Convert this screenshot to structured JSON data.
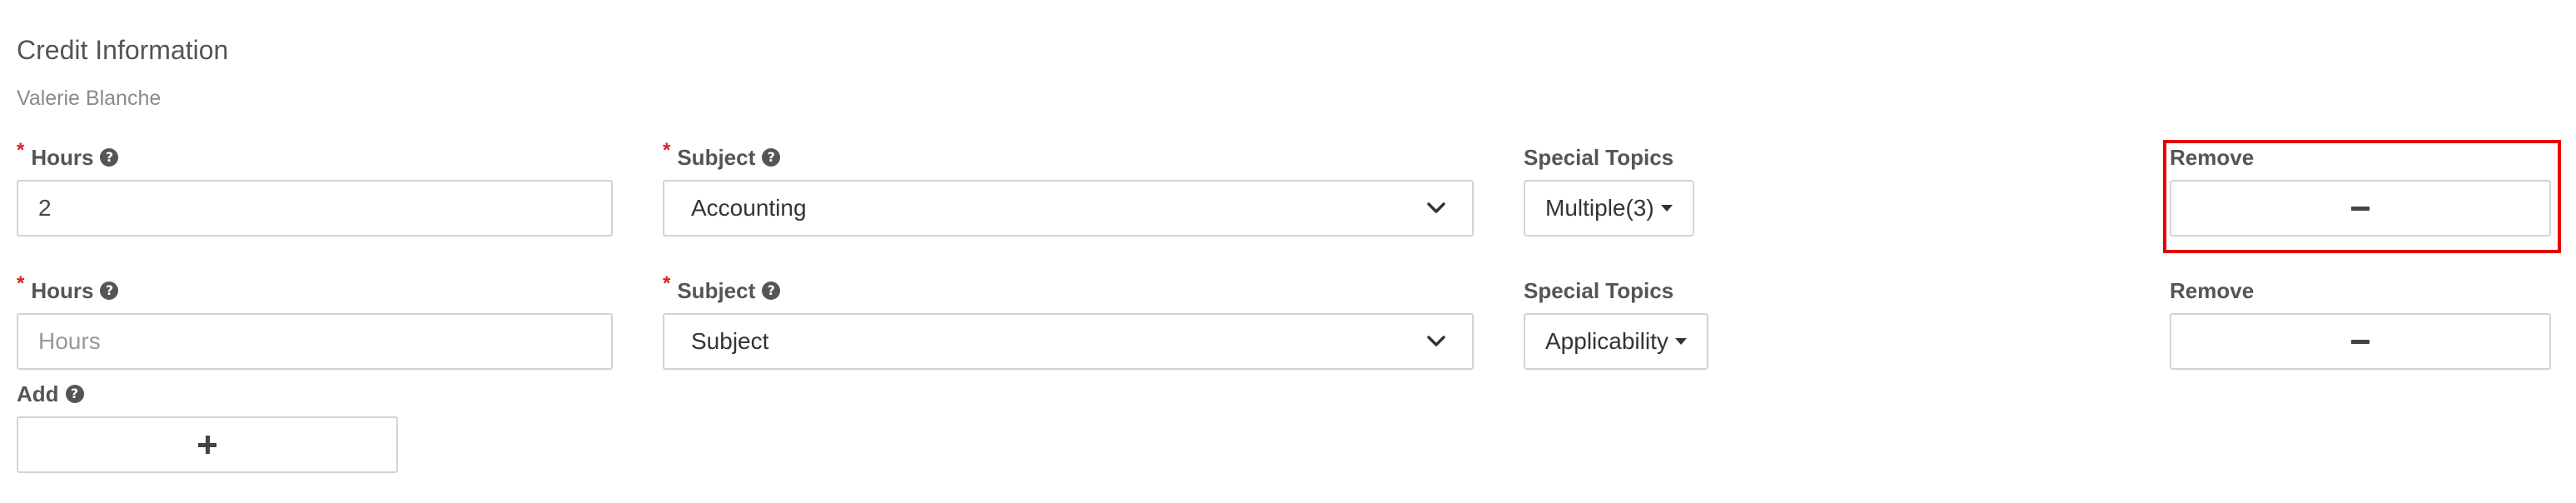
{
  "section": {
    "title": "Credit Information",
    "subtitle": "Valerie Blanche"
  },
  "labels": {
    "hours": "Hours",
    "subject": "Subject",
    "special_topics": "Special Topics",
    "remove": "Remove",
    "add": "Add",
    "required_marker": "*"
  },
  "rows": [
    {
      "hours_value": "2",
      "hours_placeholder": "Hours",
      "subject_value": "Accounting",
      "special_topics_value": "Multiple(3)"
    },
    {
      "hours_value": "",
      "hours_placeholder": "Hours",
      "subject_value": "Subject",
      "special_topics_value": "Applicability"
    }
  ],
  "icons": {
    "help": "question-circle-icon",
    "remove": "minus-icon",
    "add": "plus-icon",
    "select": "chevron-down-icon",
    "dropdown": "caret-down-icon"
  },
  "colors": {
    "required": "#e02020",
    "highlight": "#e60000",
    "border": "#d3d3d3",
    "label": "#555555"
  }
}
